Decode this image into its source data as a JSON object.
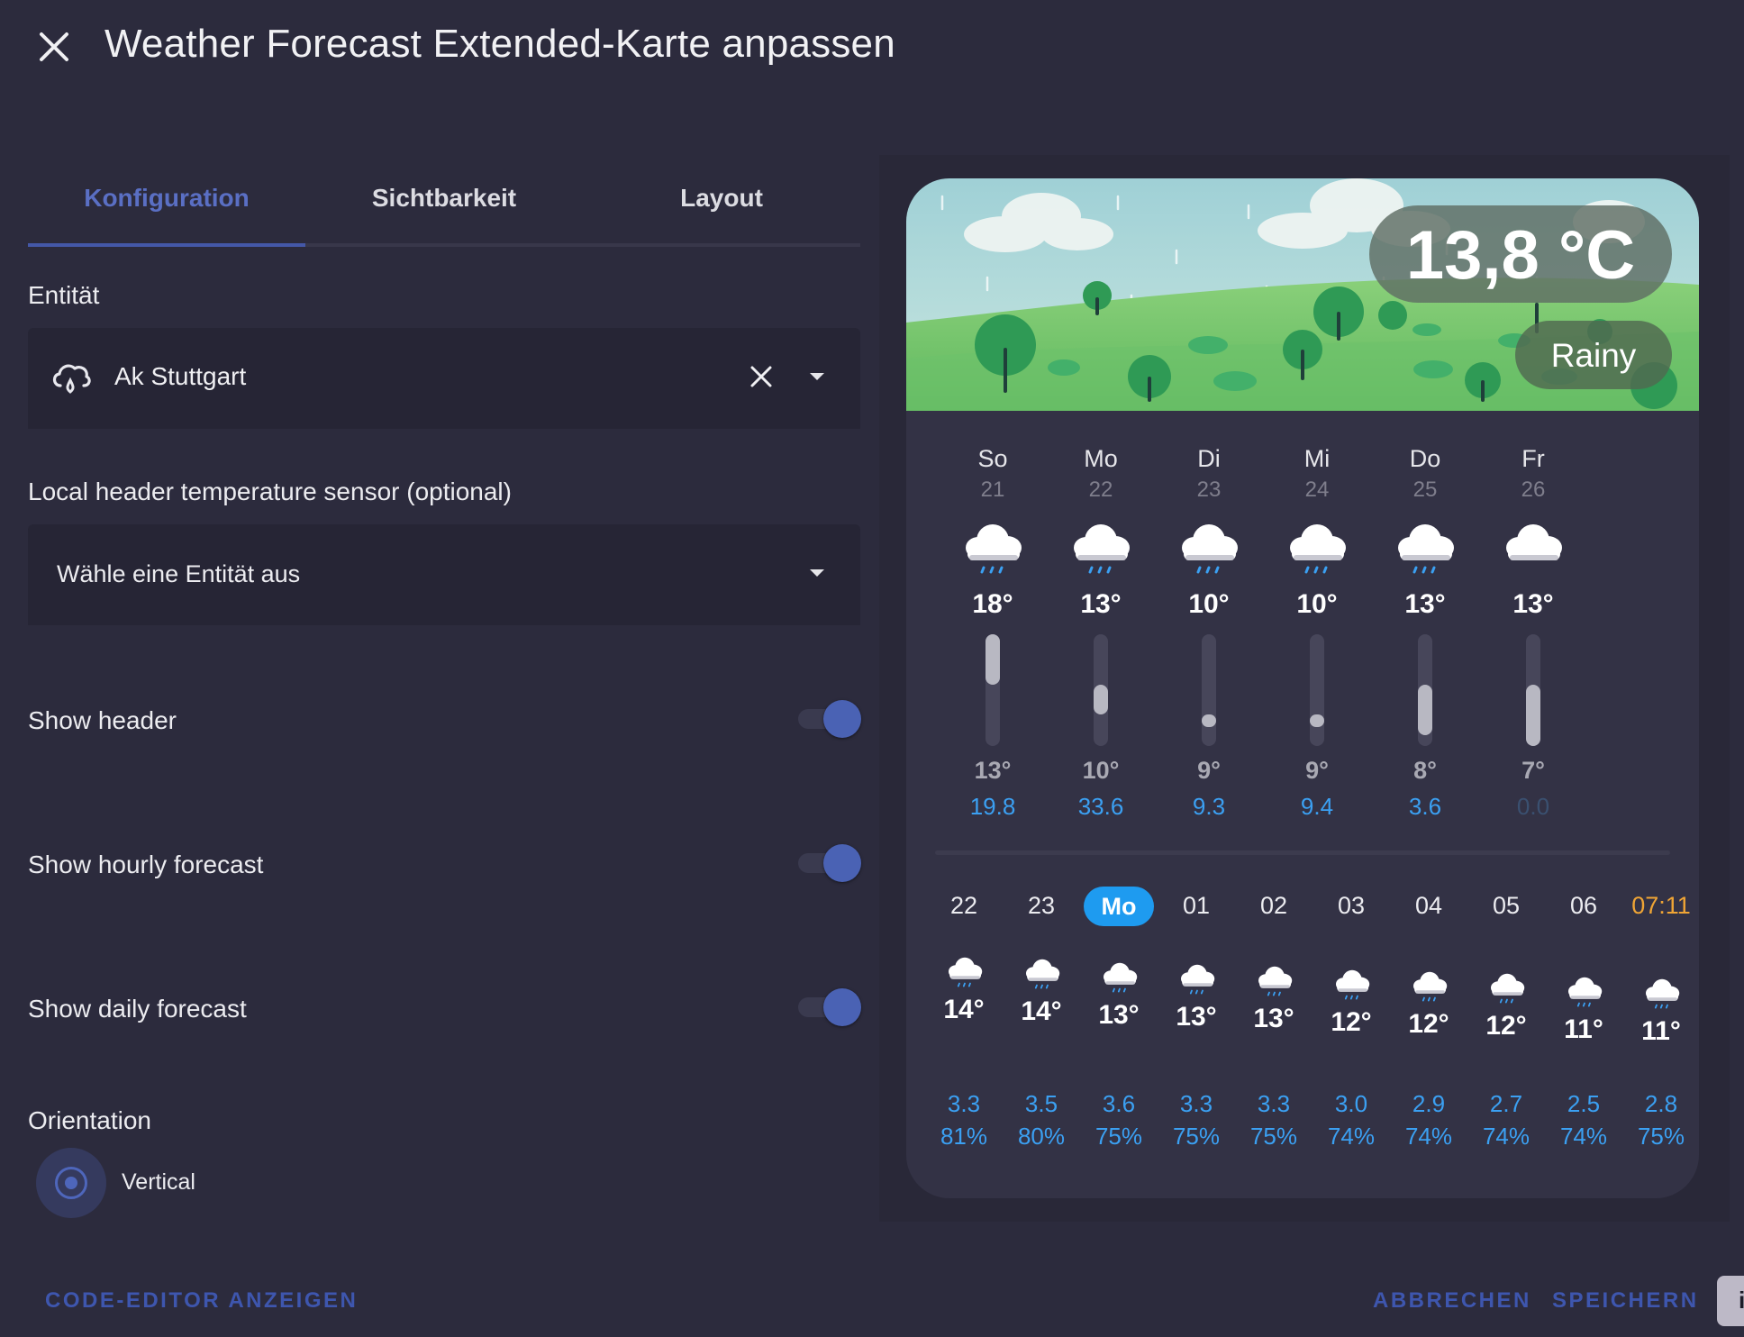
{
  "dialog": {
    "title": "Weather Forecast Extended-Karte anpassen",
    "close_icon": "close-icon"
  },
  "tabs": [
    {
      "label": "Konfiguration",
      "active": true
    },
    {
      "label": "Sichtbarkeit",
      "active": false
    },
    {
      "label": "Layout",
      "active": false
    }
  ],
  "form": {
    "entity_label": "Entität",
    "entity_value": "Ak Stuttgart",
    "entity_icon": "weather-rainy-icon",
    "sensor_label": "Local header temperature sensor (optional)",
    "sensor_placeholder": "Wähle eine Entität aus",
    "show_header_label": "Show header",
    "show_header": true,
    "show_hourly_label": "Show hourly forecast",
    "show_hourly": true,
    "show_daily_label": "Show daily forecast",
    "show_daily": true,
    "orientation_label": "Orientation",
    "orientation_value": "Vertical"
  },
  "footer": {
    "code_editor": "CODE-EDITOR ANZEIGEN",
    "cancel": "ABBRECHEN",
    "save": "SPEICHERN",
    "corner_chip": "i"
  },
  "preview": {
    "temperature": "13,8 °C",
    "condition": "Rainy",
    "daily": [
      {
        "day": "So",
        "date": "21",
        "high": "18°",
        "low": "13°",
        "precip": "19.8",
        "bar_from": 0.0,
        "bar_to": 0.45,
        "icon": "rainy-cloud-icon"
      },
      {
        "day": "Mo",
        "date": "22",
        "high": "13°",
        "low": "10°",
        "precip": "33.6",
        "bar_from": 0.45,
        "bar_to": 0.72,
        "icon": "rainy-cloud-icon"
      },
      {
        "day": "Di",
        "date": "23",
        "high": "10°",
        "low": "9°",
        "precip": "9.3",
        "bar_from": 0.72,
        "bar_to": 0.81,
        "icon": "rainy-cloud-icon"
      },
      {
        "day": "Mi",
        "date": "24",
        "high": "10°",
        "low": "9°",
        "precip": "9.4",
        "bar_from": 0.72,
        "bar_to": 0.81,
        "icon": "rainy-cloud-icon"
      },
      {
        "day": "Do",
        "date": "25",
        "high": "13°",
        "low": "8°",
        "precip": "3.6",
        "bar_from": 0.45,
        "bar_to": 0.9,
        "icon": "rainy-cloud-icon"
      },
      {
        "day": "Fr",
        "date": "26",
        "high": "13°",
        "low": "7°",
        "precip": "0.0",
        "bar_from": 0.45,
        "bar_to": 1.0,
        "icon": "cloudy-icon"
      }
    ],
    "hourly": [
      {
        "label": "22",
        "temp": "14°",
        "precip": "3.3",
        "humidity": "81%",
        "kind": "normal"
      },
      {
        "label": "23",
        "temp": "14°",
        "precip": "3.5",
        "humidity": "80%",
        "kind": "normal"
      },
      {
        "label": "Mo",
        "temp": "13°",
        "precip": "3.6",
        "humidity": "75%",
        "kind": "current"
      },
      {
        "label": "01",
        "temp": "13°",
        "precip": "3.3",
        "humidity": "75%",
        "kind": "normal"
      },
      {
        "label": "02",
        "temp": "13°",
        "precip": "3.3",
        "humidity": "75%",
        "kind": "normal"
      },
      {
        "label": "03",
        "temp": "12°",
        "precip": "3.0",
        "humidity": "74%",
        "kind": "normal"
      },
      {
        "label": "04",
        "temp": "12°",
        "precip": "2.9",
        "humidity": "74%",
        "kind": "normal"
      },
      {
        "label": "05",
        "temp": "12°",
        "precip": "2.7",
        "humidity": "74%",
        "kind": "normal"
      },
      {
        "label": "06",
        "temp": "11°",
        "precip": "2.5",
        "humidity": "74%",
        "kind": "normal"
      },
      {
        "label": "07:11",
        "temp": "11°",
        "precip": "2.8",
        "humidity": "75%",
        "kind": "sunrise"
      }
    ]
  },
  "colors": {
    "accent": "#4a62b4",
    "background": "#2c2b3d",
    "precip_blue": "#3ba0f2",
    "sunrise_orange": "#f0a535",
    "current_hour": "#1e9bf0"
  }
}
